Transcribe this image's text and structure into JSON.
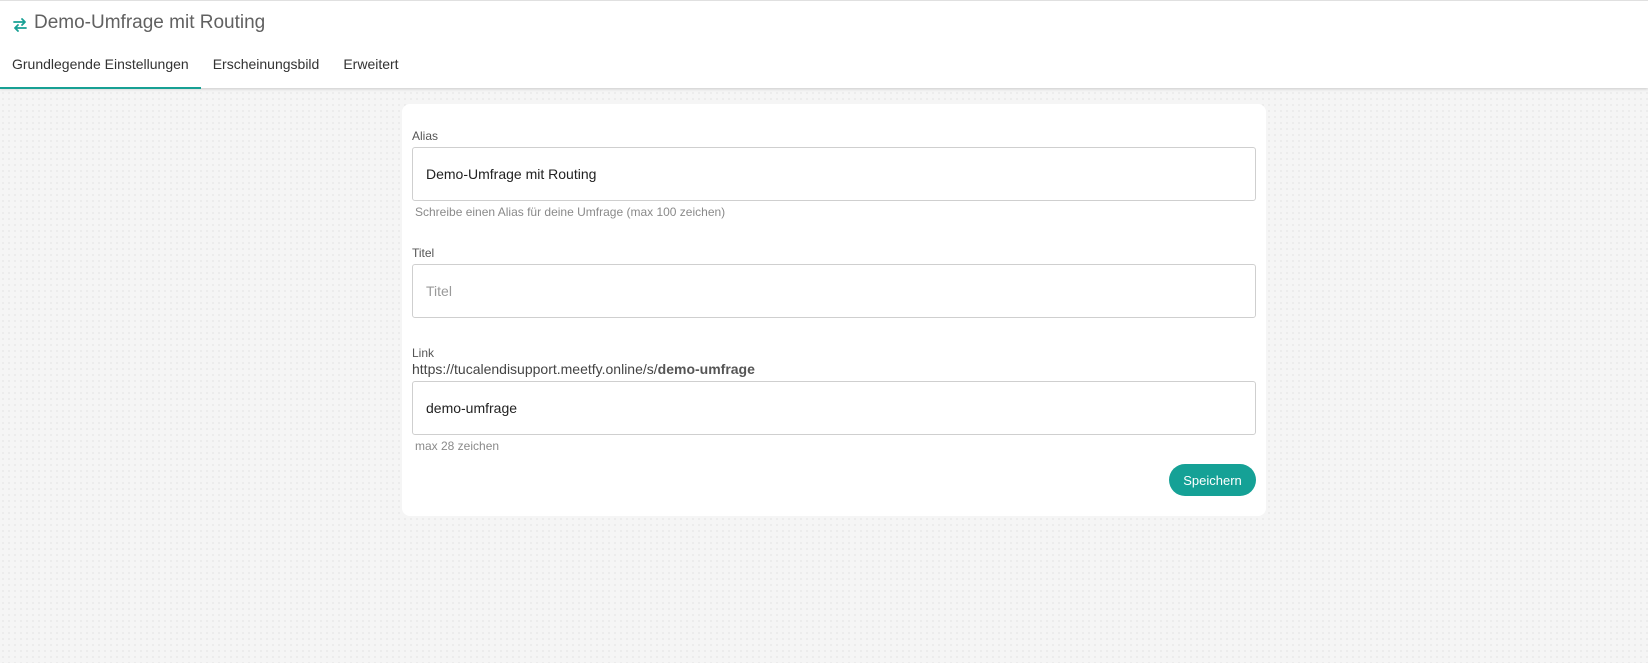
{
  "header": {
    "title": "Demo-Umfrage mit Routing",
    "icon": "route-icon",
    "accent_color": "#17a094"
  },
  "tabs": [
    {
      "label": "Grundlegende Einstellungen",
      "active": true
    },
    {
      "label": "Erscheinungsbild",
      "active": false
    },
    {
      "label": "Erweitert",
      "active": false
    }
  ],
  "form": {
    "alias": {
      "label": "Alias",
      "value": "Demo-Umfrage mit Routing",
      "hint": "Schreibe einen Alias für deine Umfrage (max 100 zeichen)"
    },
    "title": {
      "label": "Titel",
      "value": "",
      "placeholder": "Titel"
    },
    "link": {
      "label": "Link",
      "url_prefix": "https://tucalendisupport.meetfy.online/s/",
      "url_slug": "demo-umfrage",
      "value": "demo-umfrage",
      "hint": "max 28 zeichen"
    },
    "save_label": "Speichern",
    "button_color": "#15a196"
  }
}
